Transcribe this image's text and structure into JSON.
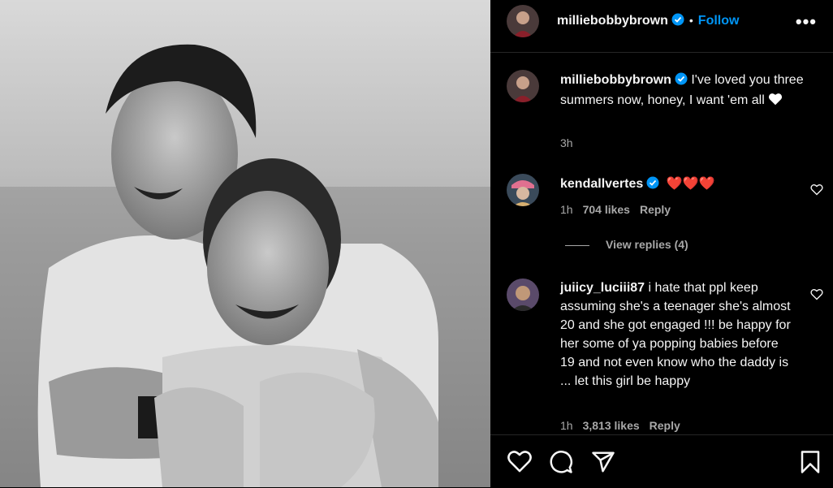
{
  "post": {
    "author": "milliebobbybrown",
    "follow_label": "Follow",
    "dot": "•",
    "more_label": "•••",
    "caption_author": "milliebobbybrown",
    "caption_text": "I've loved you three summers now, honey, I want 'em all",
    "caption_time": "3h"
  },
  "comments": [
    {
      "author": "kendallvertes",
      "text": "❤️❤️❤️",
      "time": "1h",
      "likes": "704 likes",
      "reply": "Reply",
      "view_replies": "View replies (4)"
    },
    {
      "author": "juiicy_luciii87",
      "text": "i hate that ppl keep assuming she's a teenager she's almost 20 and she got engaged !!! be happy for her some of ya popping babies before 19 and not even know who the daddy is ... let this girl be happy",
      "time": "1h",
      "likes": "3,813 likes",
      "reply": "Reply"
    }
  ],
  "colors": {
    "accent": "#0095f6",
    "verified": "#0095f6",
    "heart": "#ff3040"
  },
  "icons": [
    "verified-icon",
    "heart-icon",
    "comment-icon",
    "share-icon",
    "bookmark-icon",
    "more-icon"
  ]
}
